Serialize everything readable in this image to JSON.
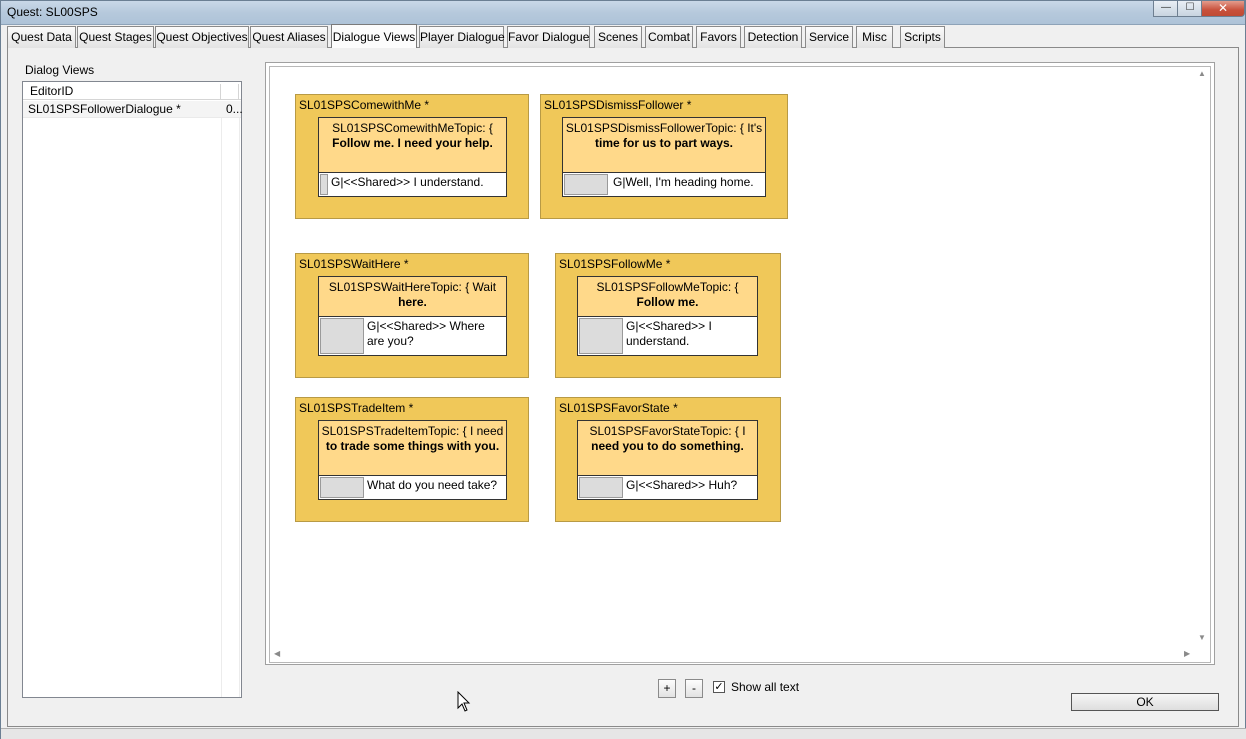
{
  "window": {
    "title": "Quest: SL00SPS",
    "minimize_symbol": "—",
    "maximize_symbol": "☐",
    "close_symbol": "✕"
  },
  "tabs": [
    {
      "label": "Quest Data"
    },
    {
      "label": "Quest Stages"
    },
    {
      "label": "Quest Objectives"
    },
    {
      "label": "Quest Aliases"
    },
    {
      "label": "Dialogue Views"
    },
    {
      "label": "Player Dialogue"
    },
    {
      "label": "Favor Dialogue"
    },
    {
      "label": "Scenes"
    },
    {
      "label": "Combat"
    },
    {
      "label": "Favors"
    },
    {
      "label": "Detection"
    },
    {
      "label": "Service"
    },
    {
      "label": "Misc"
    },
    {
      "label": "Scripts"
    }
  ],
  "active_tab": "Dialogue Views",
  "dialog_views": {
    "label": "Dialog Views",
    "column_header": "EditorID",
    "rows": [
      {
        "editor_id": "SL01SPSFollowerDialogue *",
        "col2": "0..."
      }
    ]
  },
  "nodes": [
    {
      "title": "SL01SPSComewithMe *",
      "topic_name": "SL01SPSComewithMeTopic: {",
      "topic_text": "Follow me. I need your help.",
      "response": "G|<<Shared>> I understand."
    },
    {
      "title": "SL01SPSDismissFollower *",
      "topic_name": "SL01SPSDismissFollowerTopic: { It's",
      "topic_text": "time for us to part ways.",
      "response": "G|Well, I'm heading home."
    },
    {
      "title": "SL01SPSWaitHere *",
      "topic_name": "SL01SPSWaitHereTopic: { Wait",
      "topic_text": "here.",
      "response": "G|<<Shared>> Where are you?"
    },
    {
      "title": "SL01SPSFollowMe *",
      "topic_name": "SL01SPSFollowMeTopic: {",
      "topic_text": "Follow me.",
      "response": "G|<<Shared>> I understand."
    },
    {
      "title": "SL01SPSTradeItem *",
      "topic_name": "SL01SPSTradeItemTopic: { I need",
      "topic_text": "to trade some things with you.",
      "response": "What do you need take?"
    },
    {
      "title": "SL01SPSFavorState *",
      "topic_name": "SL01SPSFavorStateTopic: { I",
      "topic_text": "need you to do something.",
      "response": "G|<<Shared>> Huh?"
    }
  ],
  "controls": {
    "zoom_in": "+",
    "zoom_out": "-",
    "show_all_text_label": "Show all text",
    "show_all_text_checked": true,
    "check_mark": "✓",
    "ok_label": "OK"
  },
  "colors": {
    "node_fill": "#f0c859",
    "topic_fill": "#ffd98a",
    "canvas_bg": "#ffffff"
  }
}
